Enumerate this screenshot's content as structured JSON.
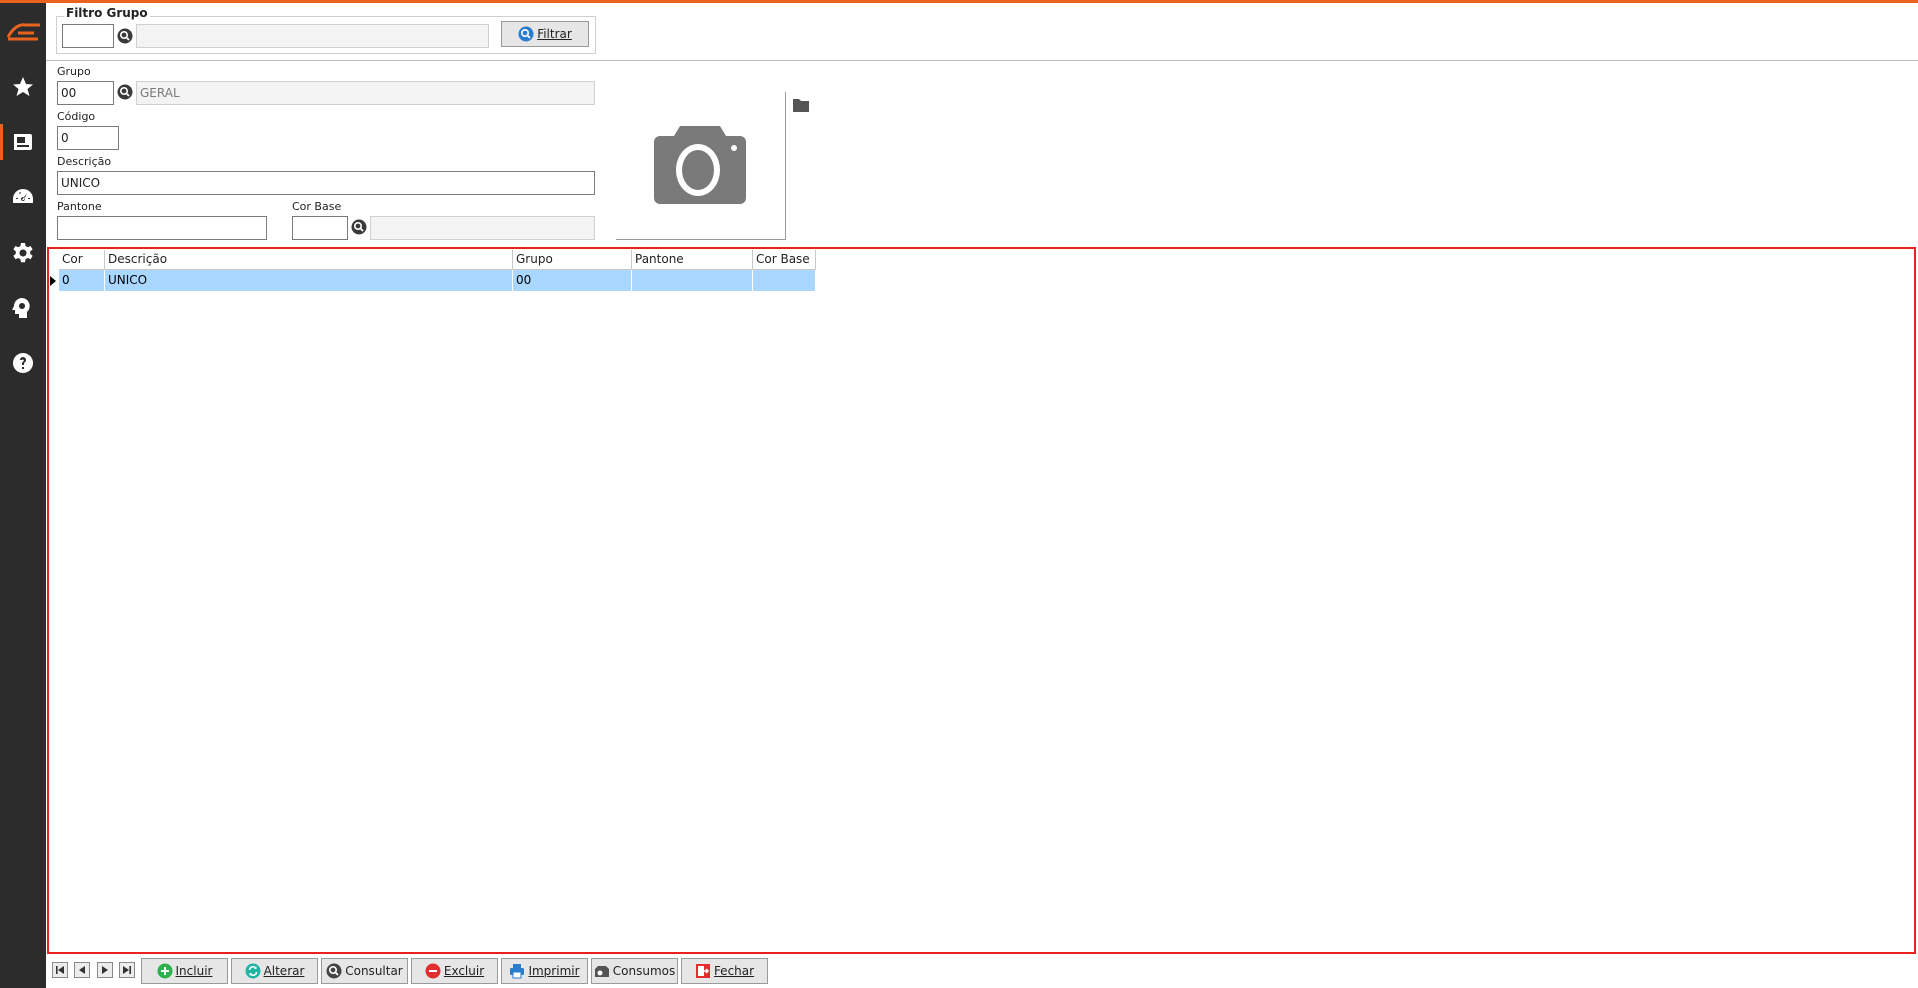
{
  "filter": {
    "legend": "Filtro Grupo",
    "code_value": "",
    "desc_value": "",
    "button_label": "Filtrar"
  },
  "form": {
    "grupo_label": "Grupo",
    "grupo_code": "00",
    "grupo_desc": "GERAL",
    "codigo_label": "Código",
    "codigo_value": "0",
    "descricao_label": "Descrição",
    "descricao_value": "UNICO",
    "pantone_label": "Pantone",
    "pantone_value": "",
    "corbase_label": "Cor Base",
    "corbase_code": "",
    "corbase_desc": ""
  },
  "grid": {
    "columns": [
      "Cor",
      "Descrição",
      "Grupo",
      "Pantone",
      "Cor Base"
    ],
    "rows": [
      [
        "0",
        "UNICO",
        "00",
        "",
        ""
      ]
    ]
  },
  "toolbar": {
    "incluir": "Incluir",
    "alterar": "Alterar",
    "consultar": "Consultar",
    "excluir": "Excluir",
    "imprimir": "Imprimir",
    "consumos": "Consumos",
    "fechar": "Fechar"
  },
  "colors": {
    "accent": "#e8641e",
    "sidebar": "#2c2c2c",
    "selection": "#a9d7ff",
    "grid_border": "#e8221e"
  },
  "icons": {
    "sidebar": [
      "logo",
      "star-icon",
      "register-icon",
      "dashboard-icon",
      "gear-icon",
      "brain-gear-icon",
      "help-icon"
    ]
  }
}
